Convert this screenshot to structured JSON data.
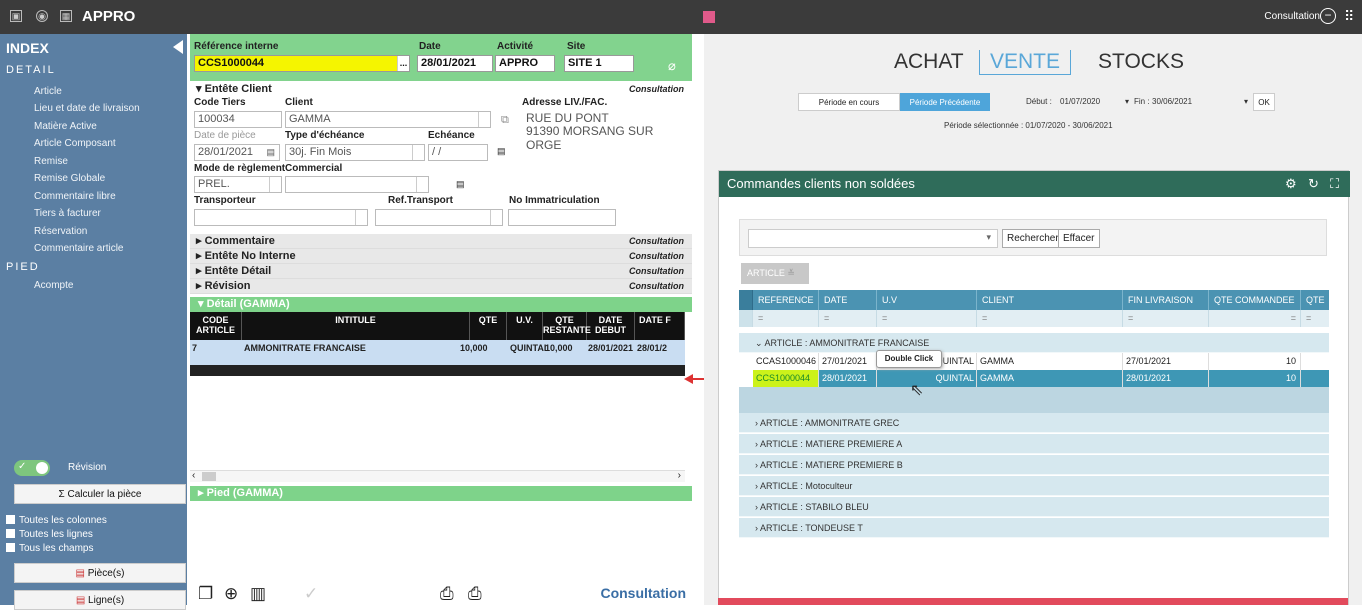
{
  "app": {
    "title": "APPRO",
    "mode": "Consultation"
  },
  "sidebar": {
    "index": "INDEX",
    "detail_header": "DETAIL",
    "pied_header": "PIED",
    "detail_items": [
      "Article",
      "Lieu et date de livraison",
      "Matière Active",
      "Article Composant",
      "Remise",
      "Remise Globale",
      "Commentaire libre",
      "Tiers à facturer",
      "Réservation",
      "Commentaire article"
    ],
    "pied_items": [
      "Acompte"
    ],
    "revision": "Révision",
    "calc": "Calculer la pièce",
    "checks": [
      "Toutes les colonnes",
      "Toutes les lignes",
      "Tous les champs"
    ],
    "btn_pieces": "Pièce(s)",
    "btn_lignes": "Ligne(s)"
  },
  "doc": {
    "ref_label": "Référence interne",
    "ref": "CCS1000044",
    "date_label": "Date",
    "date": "28/01/2021",
    "activite_label": "Activité",
    "activite": "APPRO",
    "site_label": "Site",
    "site": "SITE 1",
    "entete": "Entête Client",
    "consultation": "Consultation",
    "code_tiers_label": "Code Tiers",
    "code_tiers": "100034",
    "client_label": "Client",
    "client": "GAMMA",
    "adresse_label": "Adresse LIV./FAC.",
    "adresse1": "RUE DU PONT",
    "adresse2": "91390  MORSANG SUR ORGE",
    "date_piece_label": "Date de pièce",
    "date_piece": "28/01/2021",
    "echeance_type_label": "Type d'échéance",
    "echeance_type": "30j. Fin Mois",
    "echeance_label": "Echéance",
    "echeance": "/ /",
    "mode_reg_label": "Mode de règlement",
    "mode_reg": "PREL.",
    "commercial_label": "Commercial",
    "transporteur_label": "Transporteur",
    "ref_transport_label": "Ref.Transport",
    "immat_label": "No Immatriculation",
    "sections": [
      "Commentaire",
      "Entête No Interne",
      "Entête Détail",
      "Révision"
    ],
    "detail_title": "Détail (GAMMA)",
    "pied_title": "Pied (GAMMA)",
    "footer_mode": "Consultation"
  },
  "detail_table": {
    "headers": [
      "CODE ARTICLE",
      "INTITULE",
      "QTE",
      "U.V.",
      "QTE RESTANTE",
      "DATE DEBUT",
      "DATE F"
    ],
    "row": [
      "7",
      "AMMONITRATE FRANCAISE",
      "10,000",
      "QUINTAL",
      "10,000",
      "28/01/2021",
      "28/01/2"
    ]
  },
  "right": {
    "tabs": [
      "ACHAT",
      "VENTE",
      "STOCKS"
    ],
    "active_tab": "VENTE",
    "period_current": "Période en cours",
    "period_prev": "Période Précédente",
    "debut_label": "Début :",
    "debut": "01/07/2020",
    "fin_label": "Fin :",
    "fin": "30/06/2021",
    "ok": "OK",
    "period_selected": "Période sélectionnée : 01/07/2020 - 30/06/2021",
    "panel_title": "Commandes clients non soldées",
    "search": "Rechercher",
    "clear": "Effacer",
    "group_chip": "ARTICLE",
    "columns": [
      "REFERENCE",
      "DATE",
      "U.V",
      "CLIENT",
      "FIN LIVRAISON",
      "QTE COMMANDEE",
      "QTE"
    ],
    "filter": "=",
    "group_open": "ARTICLE : AMMONITRATE FRANCAISE",
    "rows": [
      [
        "CCAS1000046",
        "27/01/2021",
        "QUINTAL",
        "GAMMA",
        "27/01/2021",
        "10"
      ],
      [
        "CCS1000044",
        "28/01/2021",
        "QUINTAL",
        "GAMMA",
        "28/01/2021",
        "10"
      ]
    ],
    "groups": [
      "ARTICLE : AMMONITRATE GREC",
      "ARTICLE : MATIERE PREMIERE A",
      "ARTICLE : MATIERE PREMIERE B",
      "ARTICLE : Motoculteur",
      "ARTICLE : STABILO BLEU",
      "ARTICLE : TONDEUSE T"
    ],
    "tooltip": "Double Click"
  },
  "colors": {
    "green": "#82d38e",
    "blue": "#5b7fa3",
    "teal": "#2f6c5a",
    "gridblue": "#4b93b2",
    "red": "#e24a5c"
  }
}
